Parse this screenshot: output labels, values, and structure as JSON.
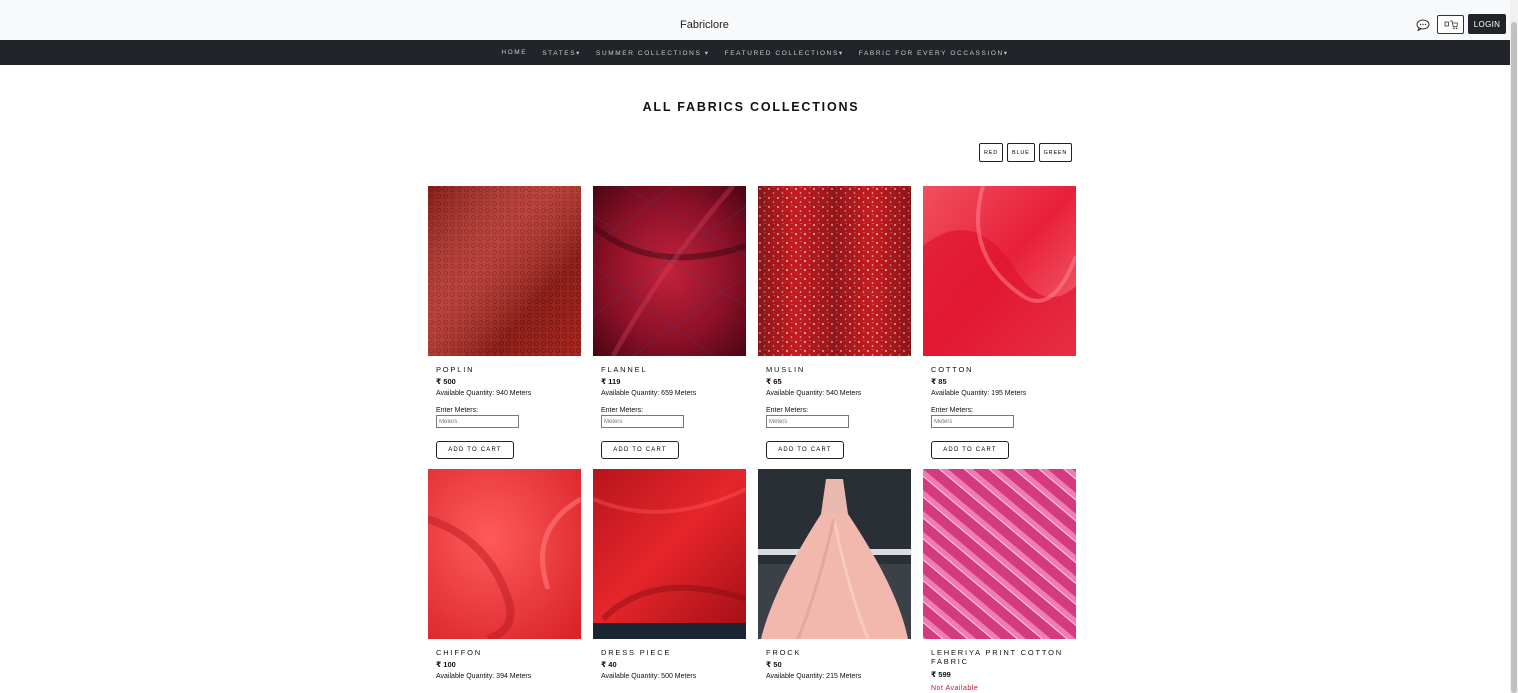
{
  "header": {
    "brand": "Fabriclore",
    "login_label": "LOGIN",
    "icons": [
      "chat-icon",
      "cart-icon"
    ]
  },
  "nav": {
    "items": [
      {
        "label": "HOME"
      },
      {
        "label": "STATES▾"
      },
      {
        "label": "SUMMER COLLECTIONS ▾"
      },
      {
        "label": "FEATURED COLLECTIONS▾"
      },
      {
        "label": "FABRIC FOR EVERY OCCASSION▾"
      }
    ]
  },
  "main": {
    "title": "ALL FABRICS COLLECTIONS",
    "filters": [
      "RED",
      "BLUE",
      "GREEN"
    ]
  },
  "products": [
    {
      "name": "POPLIN",
      "price": "₹ 500",
      "qty": "Available Quantity: 940 Meters",
      "enter_label": "Enter Meters:",
      "placeholder": "Meters",
      "button": "ADD TO CART"
    },
    {
      "name": "FLANNEL",
      "price": "₹ 119",
      "qty": "Available Quantity: 659 Meters",
      "enter_label": "Enter Meters:",
      "placeholder": "Meters",
      "button": "ADD TO CART"
    },
    {
      "name": "MUSLIN",
      "price": "₹ 65",
      "qty": "Available Quantity: 540 Meters",
      "enter_label": "Enter Meters:",
      "placeholder": "Meters",
      "button": "ADD TO CART"
    },
    {
      "name": "COTTON",
      "price": "₹ 85",
      "qty": "Available Quantity: 195 Meters",
      "enter_label": "Enter Meters:",
      "placeholder": "Meters",
      "button": "ADD TO CART"
    },
    {
      "name": "CHIFFON",
      "price": "₹ 100",
      "qty": "Available Quantity: 394 Meters"
    },
    {
      "name": "DRESS PIECE",
      "price": "₹ 40",
      "qty": "Available Quantity: 500 Meters"
    },
    {
      "name": "FROCK",
      "price": "₹ 50",
      "qty": "Available Quantity: 215 Meters"
    },
    {
      "name": "LEHERIYA PRINT COTTON FABRIC",
      "price": "₹ 599",
      "status": "Not Available"
    }
  ],
  "colors": {
    "navbar": "#212529",
    "not_available": "#c0152b"
  }
}
